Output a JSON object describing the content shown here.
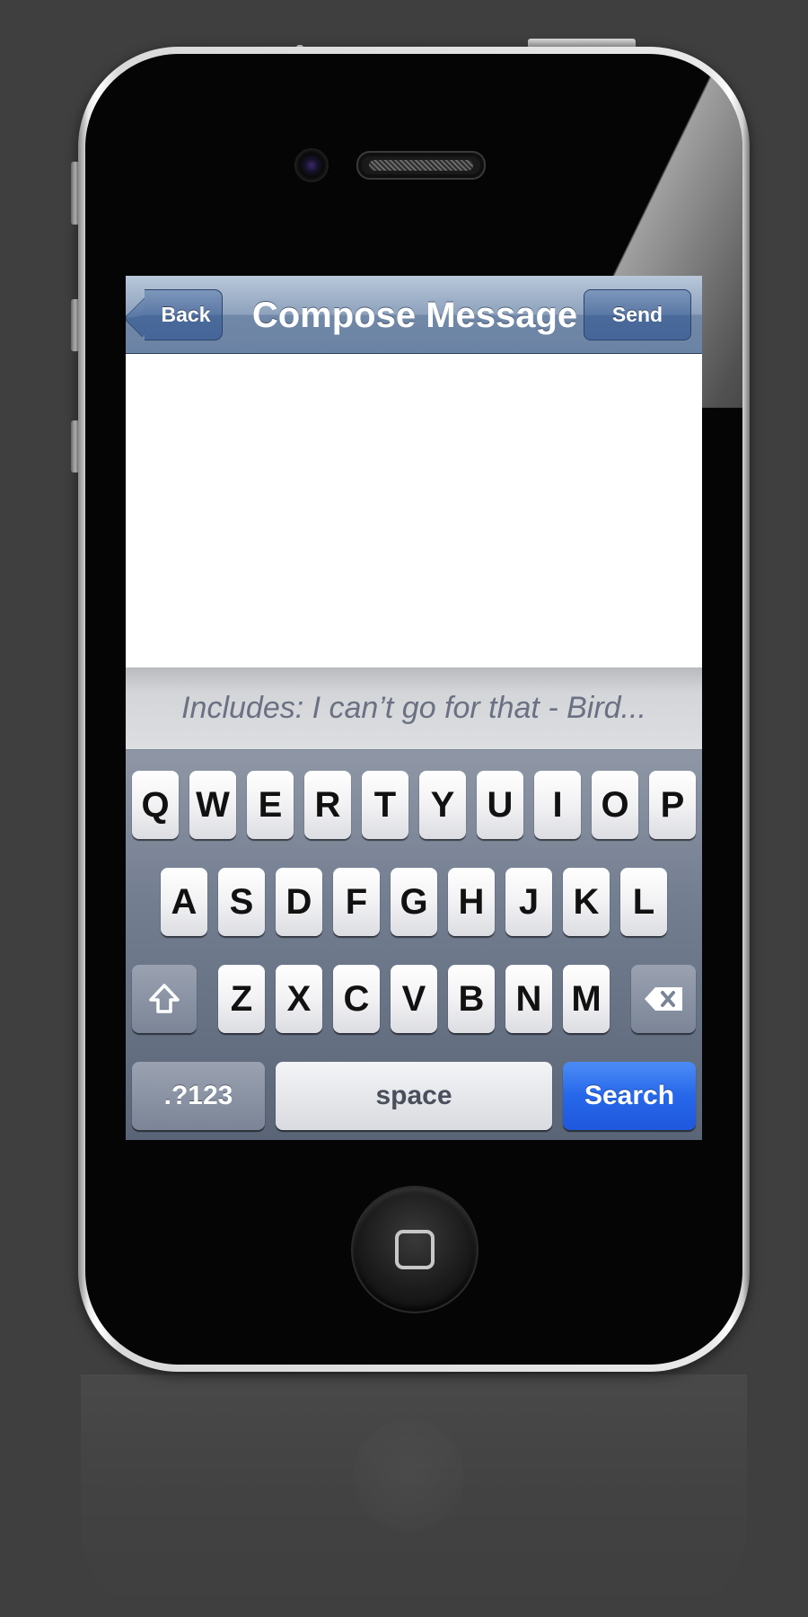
{
  "navbar": {
    "back_label": "Back",
    "title": "Compose Message",
    "send_label": "Send"
  },
  "suggestion": {
    "text": "Includes: I can’t go for that - Bird..."
  },
  "keyboard": {
    "row1": [
      "Q",
      "W",
      "E",
      "R",
      "T",
      "Y",
      "U",
      "I",
      "O",
      "P"
    ],
    "row2": [
      "A",
      "S",
      "D",
      "F",
      "G",
      "H",
      "J",
      "K",
      "L"
    ],
    "row3": [
      "Z",
      "X",
      "C",
      "V",
      "B",
      "N",
      "M"
    ],
    "shift_icon": "shift-arrow-icon",
    "delete_icon": "backspace-icon",
    "mode_label": ".?123",
    "space_label": "space",
    "return_label": "Search"
  },
  "home_button": {
    "icon": "home-square-icon"
  },
  "colors": {
    "navbar": "#8ea2bd",
    "nav_button": "#5a78a5",
    "keyboard_bg": "#727d90",
    "search_key": "#2767ea",
    "page_bg": "#3f3f3f"
  }
}
